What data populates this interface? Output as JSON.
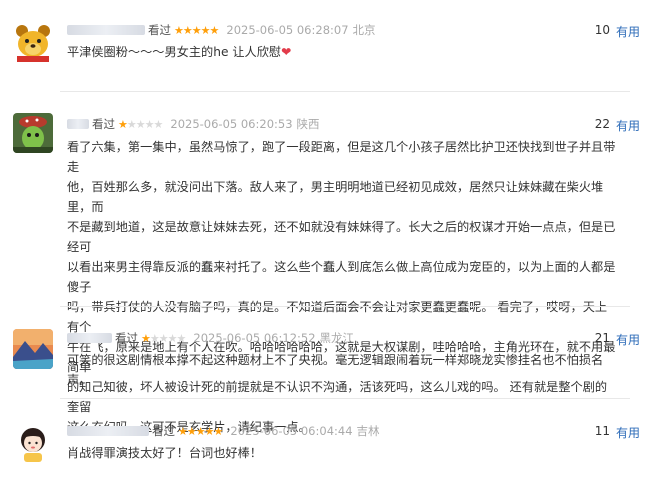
{
  "reviews": [
    {
      "status": "看过",
      "rating": 5,
      "stars_text": "★★★★★",
      "time": "2025-06-05 06:28:07",
      "location": "北京",
      "votes": "10",
      "useful_label": "有用",
      "content": "平津侯圈粉～～～男女主的he 让人欣慰",
      "content_heart": "❤"
    },
    {
      "status": "看过",
      "rating": 1,
      "stars_text": "★☆☆☆☆",
      "time": "2025-06-05 06:20:53",
      "location": "陕西",
      "votes": "22",
      "useful_label": "有用",
      "content_lines": [
        "看了六集，第一集中，虽然马惊了，跑了一段距离，但是这几个小孩子居然比护卫还快找到世子并且带走",
        "他，百姓那么多，就没问出下落。敌人来了，男主明明地道已经初见成效，居然只让妹妹藏在柴火堆里，而",
        "不是藏到地道，这是故意让妹妹去死，还不如就没有妹妹得了。长大之后的权谋才开始一点点，但是已经可",
        "以看出来男主得靠反派的蠢来衬托了。这么些个蠢人到底怎么做上高位成为宠臣的，以为上面的人都是傻子",
        "吗，带兵打仗的人没有脑子吗，真的是。不知道后面会不会让对家更蠢更蠢呢。 看完了，哎呀，天上有个",
        "牛在飞，原来是地上有个人在吹。哈哈哈哈哈哈，这就是大权谋剧，哇哈哈哈，主角光环在，就不用最简单",
        "的知己知彼，坏人被设计死的前提就是不认识不沟通，活该死吗，这么儿戏的吗。 还有就是整个剧的奎留",
        "这么玄幻吗，这可不是玄学片，请纪事一点。"
      ]
    },
    {
      "status": "看过",
      "rating": 1,
      "stars_text": "★☆☆☆☆",
      "time": "2025-06-05 06:12:52",
      "location": "黑龙江",
      "votes": "21",
      "useful_label": "有用",
      "content": "可笑的很这剧情根本撑不起这种题材上不了央视。毫无逻辑跟闹着玩一样郑晓龙实惨挂名也不怕损名声。"
    },
    {
      "status": "看过",
      "rating": 5,
      "stars_text": "★★★★★",
      "time": "2025-06-05 06:04:44",
      "location": "吉林",
      "votes": "11",
      "useful_label": "有用",
      "content": "肖战得罪演技太好了！台词也好棒！"
    }
  ],
  "colors": {
    "star_on": "#ff9f0a",
    "star_off": "#d9d9d9",
    "useful_link": "#2c6bb8",
    "heart": "#e23b4a"
  },
  "avatars": [
    "cartoon-bear-avatar",
    "green-figure-avatar",
    "landscape-avatar",
    "girl-illustration-avatar"
  ]
}
